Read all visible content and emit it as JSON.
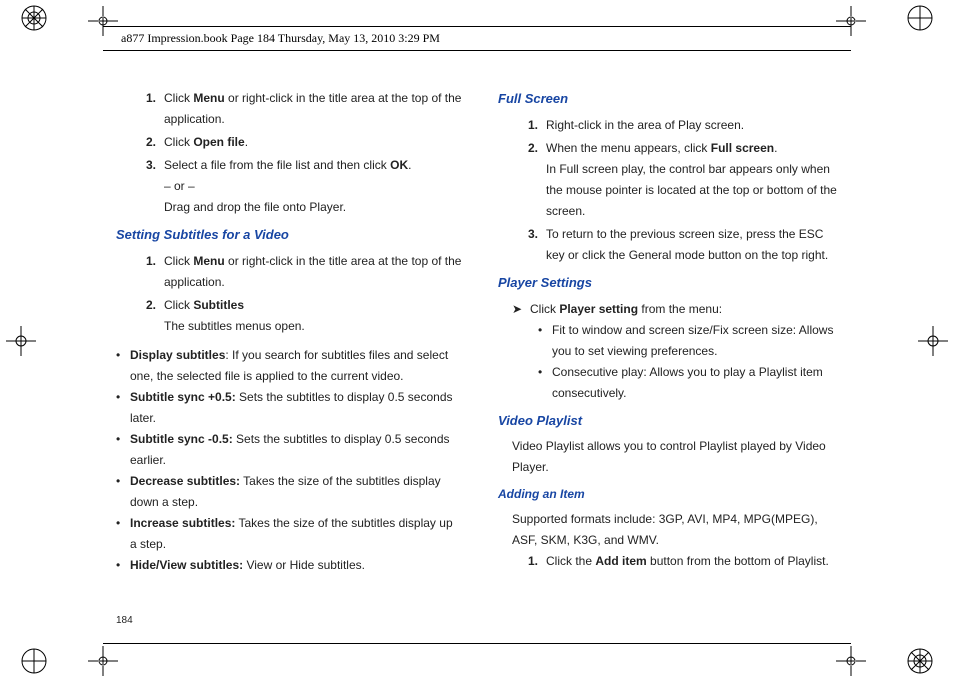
{
  "header": "a877 Impression.book  Page 184  Thursday, May 13, 2010  3:29 PM",
  "pageNumber": "184",
  "left": {
    "steps1": {
      "n1": "1.",
      "t1a": "Click ",
      "t1b": "Menu",
      "t1c": " or right-click in the title area at the top of the application.",
      "n2": "2.",
      "t2a": "Click ",
      "t2b": "Open file",
      "t2c": ".",
      "n3": "3.",
      "t3a": "Select a file from the file list and then click ",
      "t3b": "OK",
      "t3c": ".",
      "t3or": "– or –",
      "t3drag": "Drag and drop the file onto Player."
    },
    "subA": "Setting Subtitles for a Video",
    "steps2": {
      "n1": "1.",
      "t1a": "Click ",
      "t1b": "Menu",
      "t1c": " or right-click in the title area at the top of the application.",
      "n2": "2.",
      "t2a": "Click ",
      "t2b": "Subtitles",
      "t2open": "The subtitles menus open."
    },
    "bullets": {
      "b1a": "Display subtitles",
      "b1b": ": If you search for subtitles files and select one, the selected file is applied to the current video.",
      "b2a": "Subtitle sync +0.5:",
      "b2b": " Sets the subtitles to display 0.5 seconds later.",
      "b3a": "Subtitle sync -0.5:",
      "b3b": " Sets the subtitles to display 0.5 seconds earlier.",
      "b4a": "Decrease subtitles:",
      "b4b": " Takes the size of the subtitles display down a step.",
      "b5a": "Increase subtitles:",
      "b5b": " Takes the size of the subtitles display up a step.",
      "b6a": "Hide/View subtitles:",
      "b6b": " View or Hide subtitles."
    }
  },
  "right": {
    "subFS": "Full Screen",
    "fs": {
      "n1": "1.",
      "t1": "Right-click in the area of Play screen.",
      "n2": "2.",
      "t2a": "When the menu appears, click ",
      "t2b": "Full screen",
      "t2c": ".",
      "t2d": "In Full screen play, the control bar appears only when the mouse pointer is located at the top or bottom of the screen.",
      "n3": "3.",
      "t3": "To return to the previous screen size, press the ESC key or click the General mode button on the top right."
    },
    "subPS": "Player Settings",
    "psArrow": "Click ",
    "psArrowB": "Player setting",
    "psArrowC": " from the menu:",
    "psBul1": "Fit to window and screen size/Fix screen size: Allows you to set viewing preferences.",
    "psBul2": "Consecutive play: Allows you to play a Playlist item consecutively.",
    "subVP": "Video Playlist",
    "vpText": "Video Playlist allows you to control Playlist played by Video Player.",
    "subAdd": "Adding an Item",
    "addText": "Supported formats include: 3GP, AVI, MP4, MPG(MPEG), ASF, SKM, K3G, and WMV.",
    "add1n": "1.",
    "add1a": "Click the ",
    "add1b": "Add item",
    "add1c": " button from the bottom of Playlist."
  }
}
